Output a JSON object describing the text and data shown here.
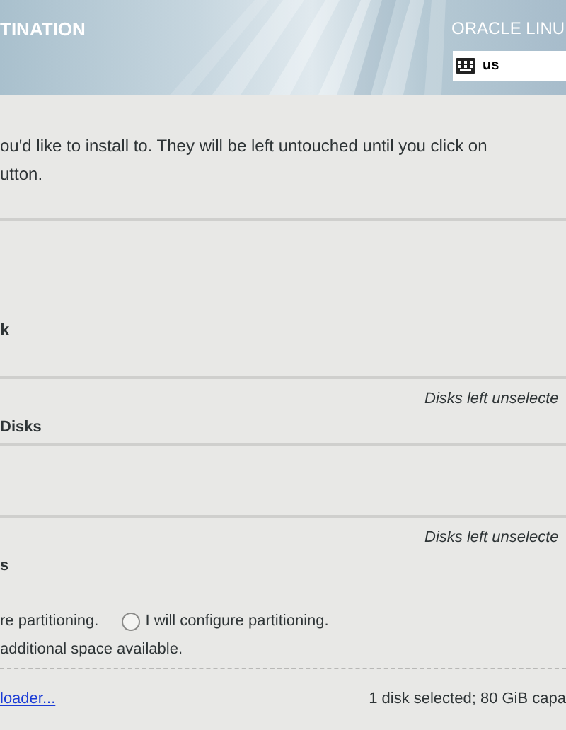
{
  "header": {
    "title": "TINATION",
    "product": "ORACLE LINU",
    "keyboard_layout": "us"
  },
  "intro": [
    "ou'd like to install to.  They will be left untouched until you click on",
    "utton."
  ],
  "local_section": {
    "heading": "k"
  },
  "specialized_section": {
    "note": "Disks left unselecte",
    "heading": "Disks"
  },
  "other_section": {
    "note": "Disks left unselecte",
    "heading": "s"
  },
  "partitioning": [
    {
      "label": "re partitioning.",
      "kind": "text"
    },
    {
      "label": "I will configure partitioning.",
      "kind": "radio",
      "selected": false
    }
  ],
  "space_option": "additional space available.",
  "footer": {
    "link": "loader...",
    "summary": "1 disk selected; 80 GiB capa"
  }
}
